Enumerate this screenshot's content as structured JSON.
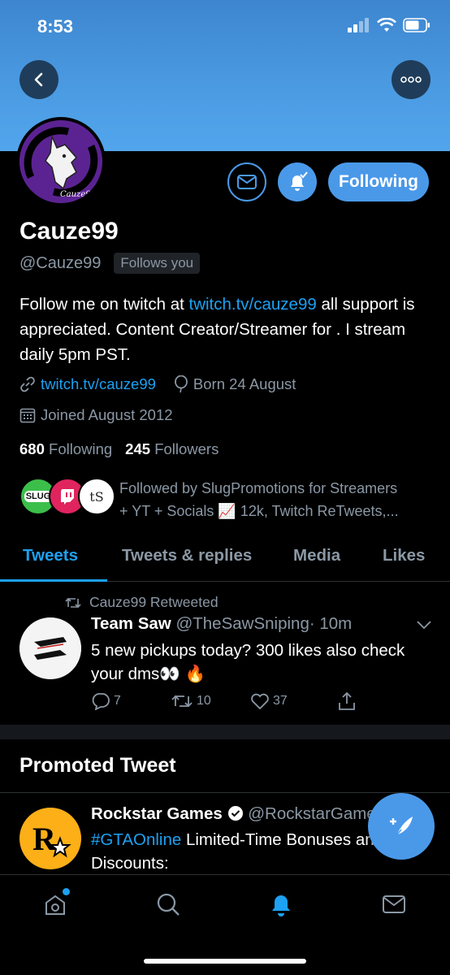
{
  "status_bar": {
    "time": "8:53"
  },
  "profile": {
    "name": "Cauze99",
    "handle": "@Cauze99",
    "follows_you_badge": "Follows you",
    "follow_button": "Following",
    "bio_prefix": "Follow me on twitch at ",
    "bio_link": "twitch.tv/cauze99",
    "bio_suffix": " all support is appreciated. Content Creator/Streamer for . I stream daily 5pm PST.",
    "website": "twitch.tv/cauze99",
    "birthday": "Born 24 August",
    "joined": "Joined August 2012",
    "following_count": "680",
    "following_label": "Following",
    "followers_count": "245",
    "followers_label": "Followers",
    "followed_by_line1": "Followed by SlugPromotions for Streamers",
    "followed_by_line2": "+ YT + Socials 📈 12k, Twitch ReTweets,...",
    "followed_by_avatars": [
      "SLUG",
      "",
      "tS"
    ]
  },
  "tabs": [
    "Tweets",
    "Tweets & replies",
    "Media",
    "Likes"
  ],
  "tweet": {
    "retweeted_by": "Cauze99 Retweeted",
    "author_name": "Team Saw",
    "author_handle": "@TheSawSniping",
    "time": "· 10m",
    "text": "5 new pickups today? 300 likes also check your dms👀 🔥",
    "replies": "7",
    "retweets": "10",
    "likes": "37"
  },
  "promoted": {
    "section_title": "Promoted Tweet",
    "author_name": "Rockstar Games",
    "author_handle": "@RockstarGames",
    "hashtag": "#GTAOnline",
    "text": " Limited-Time Bonuses and Discounts:"
  },
  "colors": {
    "accent": "#1da1f2",
    "button": "#4a99e9",
    "banner": "#4b9be3",
    "rockstar": "#fcaf17"
  }
}
